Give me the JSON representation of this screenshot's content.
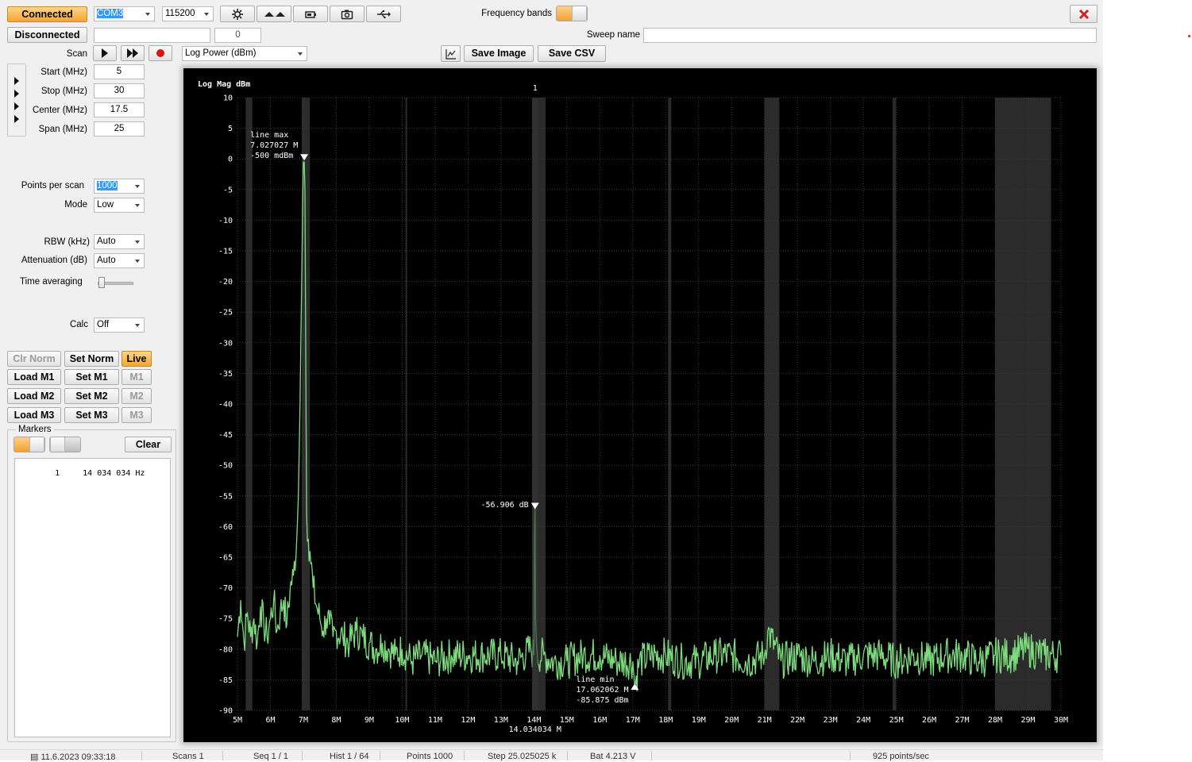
{
  "toolbar": {
    "connected_label": "Connected",
    "disconnected_label": "Disconnected",
    "port_value": "COM3",
    "baud_value": "115200",
    "status_field_value": "",
    "count_value": "0",
    "frequency_bands_label": "Frequency bands",
    "sweep_name_label": "Sweep name",
    "sweep_name_value": "",
    "save_image_label": "Save Image",
    "save_csv_label": "Save CSV",
    "close_icon": "close-icon"
  },
  "scan": {
    "label": "Scan",
    "mode_value": "Log Power (dBm)"
  },
  "freq": {
    "start_label": "Start (MHz)",
    "start_value": "5",
    "stop_label": "Stop (MHz)",
    "stop_value": "30",
    "center_label": "Center (MHz)",
    "center_value": "17.5",
    "span_label": "Span (MHz)",
    "span_value": "25"
  },
  "settings": {
    "points_label": "Points per scan",
    "points_value": "1000",
    "mode_label": "Mode",
    "mode_value": "Low",
    "rbw_label": "RBW (kHz)",
    "rbw_value": "Auto",
    "att_label": "Attenuation (dB)",
    "att_value": "Auto",
    "avg_label": "Time averaging",
    "avg_level": 0,
    "calc_label": "Calc",
    "calc_value": "Off"
  },
  "memory": {
    "clr_norm": "Clr Norm",
    "set_norm": "Set Norm",
    "live": "Live",
    "load_m1": "Load M1",
    "set_m1": "Set M1",
    "m1": "M1",
    "load_m2": "Load M2",
    "set_m2": "Set M2",
    "m2": "M2",
    "load_m3": "Load M3",
    "set_m3": "Set M3",
    "m3": "M3"
  },
  "markers": {
    "title": "Markers",
    "clear_label": "Clear",
    "list": [
      {
        "index": "1",
        "freq": "14 034 034 Hz"
      }
    ]
  },
  "status": {
    "datetime": "11.6.2023 09:33:18",
    "scans": "Scans 1",
    "seq": "Seq 1 / 1",
    "hist": "Hist 1 / 64",
    "points": "Points 1000",
    "step": "Step 25.025025 k",
    "bat": "Bat 4.213 V",
    "rate": "925 points/sec"
  },
  "chart_data": {
    "type": "line",
    "ylabel": "Log Mag dBm",
    "xlabel": "",
    "xlim": [
      5,
      30
    ],
    "ylim": [
      -90,
      10
    ],
    "x_unit": "MHz",
    "y_ticks": [
      "10",
      "5",
      "0",
      "-5",
      "-10",
      "-15",
      "-20",
      "-25",
      "-30",
      "-35",
      "-40",
      "-45",
      "-50",
      "-55",
      "-60",
      "-65",
      "-70",
      "-75",
      "-80",
      "-85",
      "-90"
    ],
    "x_ticks": [
      "5M",
      "6M",
      "7M",
      "8M",
      "9M",
      "10M",
      "11M",
      "12M",
      "13M",
      "14M",
      "15M",
      "16M",
      "17M",
      "18M",
      "19M",
      "20M",
      "21M",
      "22M",
      "23M",
      "24M",
      "25M",
      "26M",
      "27M",
      "28M",
      "29M",
      "30M"
    ],
    "grid": true,
    "band_shading": [
      [
        5.25,
        5.45
      ],
      [
        6.95,
        7.2
      ],
      [
        10.1,
        10.15
      ],
      [
        13.95,
        14.35
      ],
      [
        18.07,
        18.17
      ],
      [
        21.0,
        21.45
      ],
      [
        24.89,
        24.99
      ],
      [
        28.0,
        29.7
      ]
    ],
    "series": [
      {
        "color": "#7ddc7d",
        "x": [
          5.0,
          5.1,
          5.2,
          5.3,
          5.4,
          5.5,
          5.6,
          5.7,
          5.8,
          5.9,
          6.0,
          6.1,
          6.2,
          6.3,
          6.4,
          6.5,
          6.6,
          6.7,
          6.8,
          6.85,
          6.9,
          6.95,
          6.98,
          7.0,
          7.027,
          7.05,
          7.08,
          7.1,
          7.15,
          7.2,
          7.3,
          7.4,
          7.5,
          7.6,
          7.7,
          7.8,
          7.9,
          8.0,
          8.2,
          8.4,
          8.6,
          8.8,
          9.0,
          9.2,
          9.4,
          9.6,
          9.8,
          10.0,
          10.3,
          10.6,
          11.0,
          11.5,
          12.0,
          12.5,
          13.0,
          13.5,
          13.9,
          14.0,
          14.02,
          14.034,
          14.05,
          14.1,
          14.3,
          14.6,
          15.0,
          15.5,
          16.0,
          16.5,
          17.0,
          17.062,
          17.2,
          17.6,
          18.0,
          18.5,
          19.0,
          19.5,
          20.0,
          20.5,
          21.0,
          21.1,
          21.5,
          22.0,
          22.5,
          23.0,
          23.5,
          24.0,
          24.5,
          25.0,
          25.5,
          26.0,
          26.5,
          27.0,
          27.5,
          28.0,
          28.5,
          29.0,
          29.5,
          30.0
        ],
        "y": [
          -78,
          -72,
          -79,
          -74,
          -78,
          -75,
          -79,
          -73,
          -76,
          -78,
          -75,
          -72,
          -77,
          -74,
          -72,
          -76,
          -70,
          -68,
          -62,
          -55,
          -40,
          -20,
          -8,
          -0.5,
          -0.5,
          -5,
          -40,
          -58,
          -62,
          -64,
          -70,
          -73,
          -75,
          -77,
          -75,
          -76,
          -78,
          -77,
          -78,
          -79,
          -77,
          -78,
          -79,
          -80,
          -79,
          -80,
          -81,
          -80,
          -82,
          -81,
          -82,
          -81,
          -81,
          -81,
          -81,
          -82,
          -80,
          -81,
          -62,
          -56.9,
          -75,
          -81,
          -81,
          -82,
          -82,
          -81,
          -81,
          -82,
          -82,
          -85.9,
          -82,
          -81,
          -81,
          -82,
          -82,
          -81,
          -81,
          -82,
          -81,
          -77,
          -82,
          -81,
          -82,
          -81,
          -82,
          -81,
          -81,
          -82,
          -81,
          -82,
          -81,
          -81,
          -82,
          -81,
          -81,
          -80,
          -81,
          -81
        ]
      }
    ],
    "markers": [
      {
        "label": "line max",
        "freq": "7.027027 M",
        "value": "-500 mdBm",
        "x": 7.027,
        "y": 0
      },
      {
        "label": "1",
        "value": "-56.906 dB",
        "x": 14.034,
        "y": -56.906,
        "x_readout": "14.034034 M"
      },
      {
        "label": "line min",
        "freq": "17.062062 M",
        "value": "-85.875 dBm",
        "x": 17.062,
        "y": -85.875
      }
    ]
  }
}
